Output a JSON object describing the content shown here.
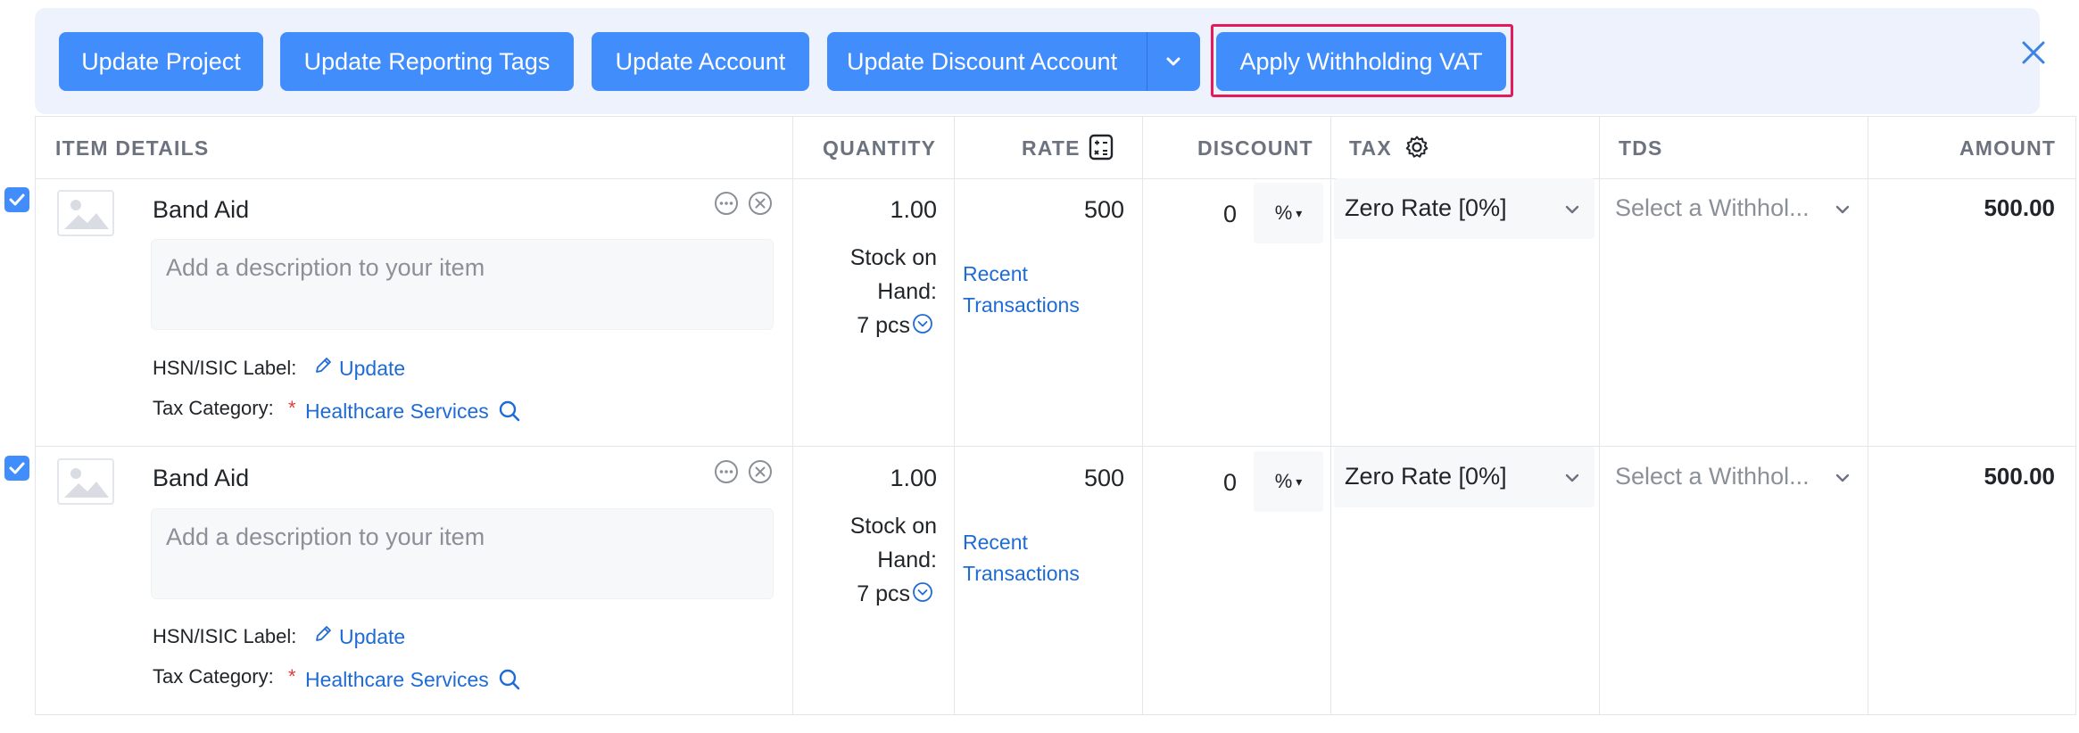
{
  "bulk_actions": {
    "update_project": "Update Project",
    "update_reporting_tags": "Update Reporting Tags",
    "update_account": "Update Account",
    "update_discount_account": "Update Discount Account",
    "apply_withholding_vat": "Apply Withholding VAT"
  },
  "columns": {
    "item_details": "ITEM DETAILS",
    "quantity": "QUANTITY",
    "rate": "RATE",
    "discount": "DISCOUNT",
    "tax": "TAX",
    "tds": "TDS",
    "amount": "AMOUNT"
  },
  "rows": [
    {
      "checked": true,
      "item_name": "Band Aid",
      "description_placeholder": "Add a description to your item",
      "hsn_label": "HSN/ISIC Label:",
      "hsn_action": "Update",
      "tax_category_label": "Tax Category:",
      "required_mark": "*",
      "tax_category_value": "Healthcare Services",
      "quantity": "1.00",
      "stock_line1": "Stock on",
      "stock_line2": "Hand:",
      "stock_line3": "7 pcs",
      "rate": "500",
      "recent_line1": "Recent",
      "recent_line2": "Transactions",
      "discount": "0",
      "discount_type": "%",
      "tax": "Zero Rate [0%]",
      "tds_placeholder": "Select a Withhol...",
      "amount": "500.00"
    },
    {
      "checked": true,
      "item_name": "Band Aid",
      "description_placeholder": "Add a description to your item",
      "hsn_label": "HSN/ISIC Label:",
      "hsn_action": "Update",
      "tax_category_label": "Tax Category:",
      "required_mark": "*",
      "tax_category_value": "Healthcare Services",
      "quantity": "1.00",
      "stock_line1": "Stock on",
      "stock_line2": "Hand:",
      "stock_line3": "7 pcs",
      "rate": "500",
      "recent_line1": "Recent",
      "recent_line2": "Transactions",
      "discount": "0",
      "discount_type": "%",
      "tax": "Zero Rate [0%]",
      "tds_placeholder": "Select a Withhol...",
      "amount": "500.00"
    }
  ],
  "colors": {
    "primary": "#408dfb",
    "link": "#1f6bd6",
    "highlight": "#e31b5d",
    "bar_bg": "#edf2fc"
  }
}
